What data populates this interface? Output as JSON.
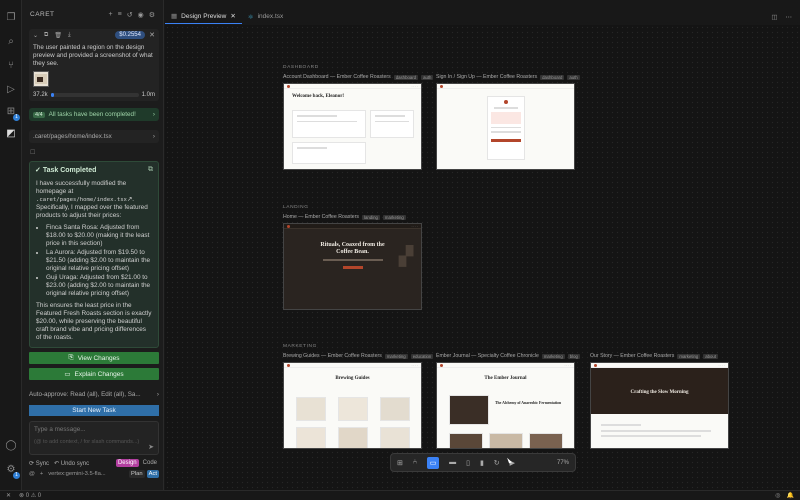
{
  "sidebar": {
    "title": "CARET",
    "task": {
      "cost": "$0.2554",
      "text": "The user painted a region on the design preview and provided a screenshot of what they see.",
      "tokens": "37.2k",
      "context_max": "1.0m",
      "context_fraction": 0.04
    },
    "done": {
      "badge": "4/4",
      "label": "All tasks have been completed!"
    },
    "path": ".caret/pages/home/index.tsx",
    "completed": {
      "title": "Task Completed",
      "intro_pre": "I have successfully modified the homepage at",
      "intro_path": ".caret/pages/home/index.tsx",
      "intro_post": ". Specifically, I mapped over the featured products to adjust their prices:",
      "bullets": [
        "Finca Santa Rosa: Adjusted from $18.00 to $20.00 (making it the least price in this section)",
        "La Aurora: Adjusted from $19.50 to $21.50 (adding $2.00 to maintain the original relative pricing offset)",
        "Guji Uraga: Adjusted from $21.00 to $23.00 (adding $2.00 to maintain the original relative pricing offset)"
      ],
      "outro": "This ensures the least price in the Featured Fresh Roasts section is exactly $20.00, while preserving the beautiful craft brand vibe and pricing differences of the roasts."
    },
    "view_changes": "View Changes",
    "explain_changes": "Explain Changes",
    "auto_approve": "Auto-approve: Read (all), Edit (all), Sa...",
    "start_new_task": "Start New Task",
    "message_placeholder": "Type a message...",
    "message_hint": "(@ to add context, / for slash commands...)",
    "sync": "Sync",
    "undo_sync": "Undo sync",
    "mode_design": "Design",
    "mode_code": "Code",
    "model": "vertex:gemini-3.5-fla...",
    "plan": "Plan",
    "act": "Act"
  },
  "tabs": [
    {
      "label": "Design Preview",
      "active": true
    },
    {
      "label": "index.tsx",
      "active": false
    }
  ],
  "canvas": {
    "sections": {
      "dashboard": "DASHBOARD",
      "landing": "LANDING",
      "marketing": "MARKETING"
    },
    "frames": {
      "account": {
        "label": "Account Dashboard — Ember Coffee Roasters",
        "tags": [
          "dashboard",
          "auth"
        ],
        "heading": "Welcome back, Eleanor!"
      },
      "signin": {
        "label": "Sign In / Sign Up — Ember Coffee Roasters",
        "tags": [
          "dashboard",
          "auth"
        ]
      },
      "home": {
        "label": "Home — Ember Coffee Roasters",
        "tags": [
          "landing",
          "marketing"
        ],
        "heading1": "Rituals, Coaxed from the",
        "heading2": "Coffee Bean."
      },
      "brewing": {
        "label": "Brewing Guides — Ember Coffee Roasters",
        "tags": [
          "marketing",
          "education"
        ],
        "heading": "Brewing Guides"
      },
      "journal": {
        "label": "Ember Journal — Specialty Coffee Chronicle",
        "tags": [
          "marketing",
          "blog"
        ],
        "heading": "The Ember Journal",
        "post_title": "The Alchemy of Anaerobic Fermentation"
      },
      "story": {
        "label": "Our Story — Ember Coffee Roasters",
        "tags": [
          "marketing",
          "about"
        ],
        "heading": "Crafting the Slow Morning"
      }
    },
    "toolbar": {
      "zoom": "77%"
    }
  },
  "status": {
    "errors": "0",
    "warnings": "0"
  }
}
